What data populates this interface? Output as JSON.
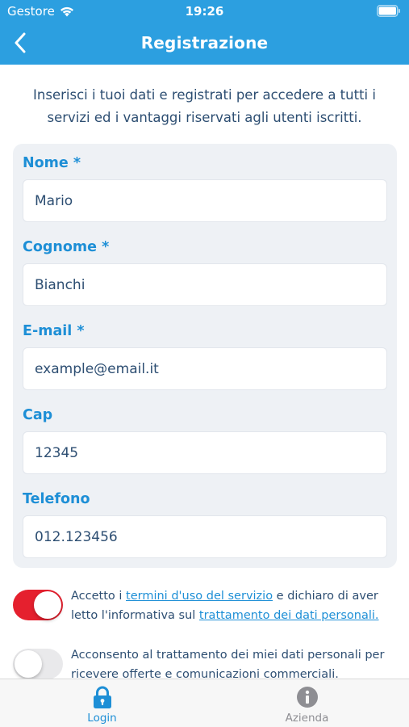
{
  "status_bar": {
    "carrier": "Gestore",
    "time": "19:26"
  },
  "header": {
    "title": "Registrazione"
  },
  "intro": "Inserisci i tuoi dati e registrati per accedere a tutti i servizi ed i vantaggi riservati agli utenti iscritti.",
  "form": {
    "nome": {
      "label": "Nome *",
      "value": "Mario"
    },
    "cognome": {
      "label": "Cognome *",
      "value": "Bianchi"
    },
    "email": {
      "label": "E-mail *",
      "value": "example@email.it"
    },
    "cap": {
      "label": "Cap",
      "value": "12345"
    },
    "telefono": {
      "label": "Telefono",
      "value": "012.123456"
    }
  },
  "consents": {
    "terms": {
      "checked": true,
      "text_1": "Accetto i ",
      "link_1": "termini d'uso del servizio",
      "text_2": " e dichiaro di aver letto l'informativa sul ",
      "link_2": "trattamento dei dati personali."
    },
    "marketing": {
      "checked": false,
      "text": "Acconsento al trattamento dei miei dati personali per ricevere offerte e comunicazioni commerciali."
    }
  },
  "tabbar": {
    "login": {
      "label": "Login",
      "icon": "lock-icon"
    },
    "azienda": {
      "label": "Azienda",
      "icon": "info-icon"
    }
  },
  "colors": {
    "header": "#2c9fe0",
    "accent": "#1e8fd6",
    "text": "#2d4e72",
    "toggle_on": "#e5202e",
    "card": "#eef1f5",
    "tab_inactive": "#8e8e93"
  }
}
